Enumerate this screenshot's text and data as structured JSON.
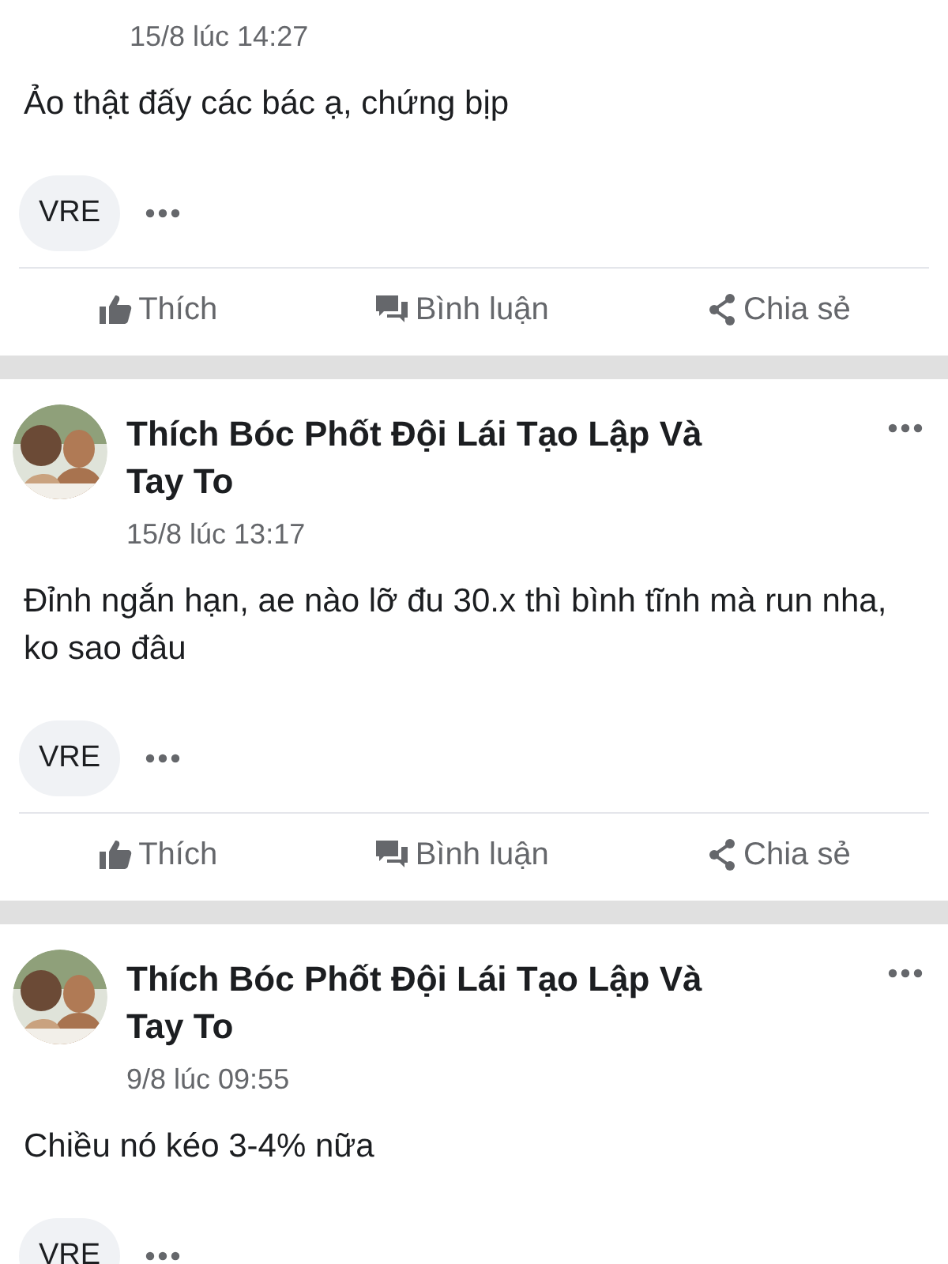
{
  "posts": [
    {
      "time": "15/8 lúc 14:27",
      "text": "Ảo thật đấy các bác ạ, chứng bịp",
      "tag": "VRE",
      "actions": [
        "Thích",
        "Bình luận",
        "Chia sẻ"
      ]
    },
    {
      "author": "Thích Bóc Phốt Đội Lái Tạo Lập Và Tay To",
      "time": "15/8 lúc 13:17",
      "text": "Đỉnh ngắn hạn, ae nào lỡ đu 30.x thì bình tĩnh mà run nha, ko sao đâu",
      "tag": "VRE",
      "actions": [
        "Thích",
        "Bình luận",
        "Chia sẻ"
      ]
    },
    {
      "author": "Thích Bóc Phốt Đội Lái Tạo Lập Và Tay To",
      "time": "9/8 lúc 09:55",
      "text": "Chiều nó kéo 3-4% nữa",
      "tag": "VRE"
    }
  ]
}
